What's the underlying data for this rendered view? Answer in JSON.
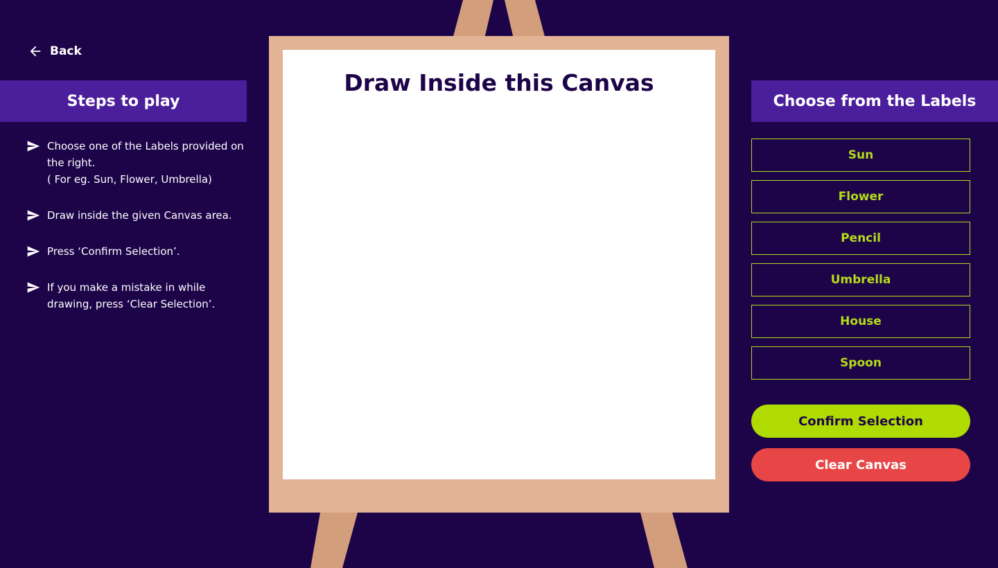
{
  "nav": {
    "back_label": "Back",
    "back_icon": "arrow-left-icon"
  },
  "steps_panel": {
    "title": "Steps to play",
    "items": [
      {
        "text": "Choose one of the Labels provided on the right.\n( For eg. Sun, Flower, Umbrella)"
      },
      {
        "text": "Draw inside the given Canvas area."
      },
      {
        "text": "Press ‘Confirm Selection’."
      },
      {
        "text": "If you make a mistake in while drawing, press ‘Clear Selection’."
      }
    ],
    "step_icon": "send-arrow-icon"
  },
  "canvas": {
    "title": "Draw Inside this Canvas"
  },
  "labels_panel": {
    "title": "Choose from the Labels",
    "options": [
      "Sun",
      "Flower",
      "Pencil",
      "Umbrella",
      "House",
      "Spoon"
    ]
  },
  "actions": {
    "confirm_label": "Confirm Selection",
    "clear_label": "Clear Canvas"
  },
  "colors": {
    "background": "#1d0449",
    "panel_header": "#4b1e9b",
    "accent_green": "#afdb00",
    "label_text": "#b5dc1a",
    "danger_red": "#e84646",
    "easel_frame": "#e2b394",
    "easel_legs": "#d39e7b"
  }
}
